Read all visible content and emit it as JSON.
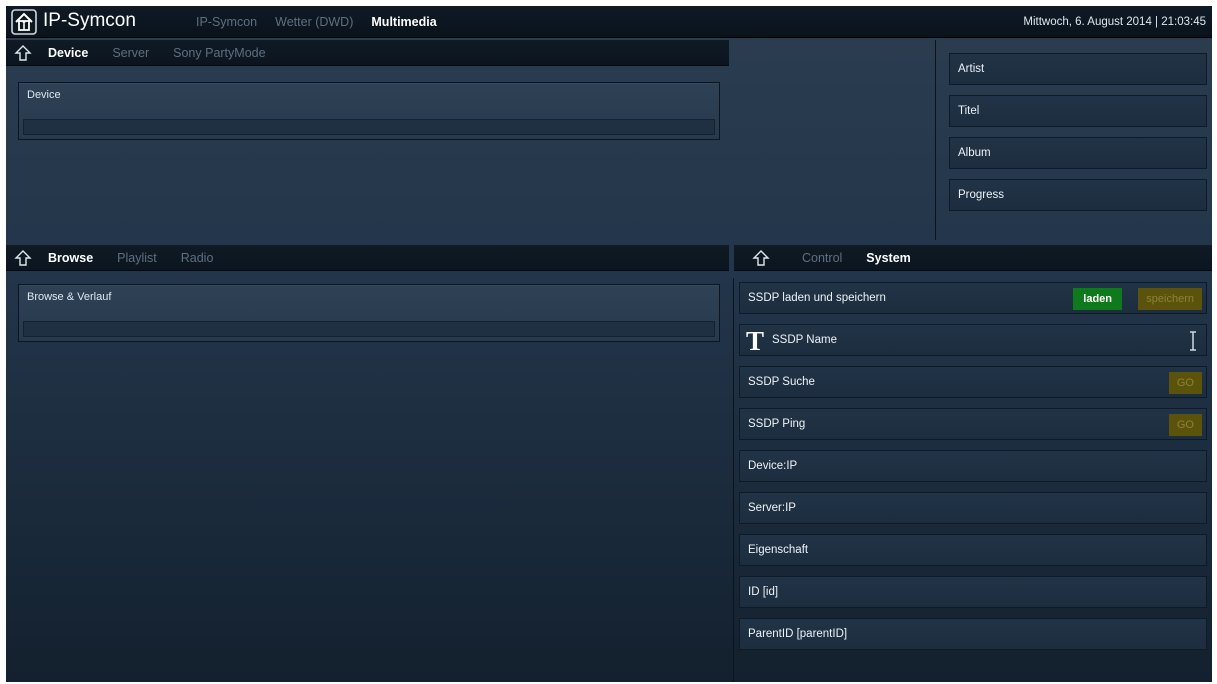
{
  "header": {
    "brand": "IP-Symcon",
    "nav": [
      "IP-Symcon",
      "Wetter (DWD)",
      "Multimedia"
    ],
    "active_nav": "Multimedia",
    "datetime": "Mittwoch, 6. August 2014 | 21:03:45"
  },
  "device_section": {
    "tabs": [
      "Device",
      "Server",
      "Sony PartyMode"
    ],
    "active_tab": "Device",
    "panel_title": "Device"
  },
  "media_info": {
    "fields": [
      "Artist",
      "Titel",
      "Album",
      "Progress"
    ]
  },
  "browse_section": {
    "tabs": [
      "Browse",
      "Playlist",
      "Radio"
    ],
    "active_tab": "Browse",
    "panel_title": "Browse & Verlauf"
  },
  "system_section": {
    "tabs": [
      "Control",
      "System"
    ],
    "active_tab": "System",
    "rows": {
      "ssdp_load_save": "SSDP laden und speichern",
      "load_button": "laden",
      "save_button": "speichern",
      "ssdp_name": "SSDP Name",
      "ssdp_search": "SSDP Suche",
      "ssdp_search_go": "GO",
      "ssdp_ping": "SSDP Ping",
      "ssdp_ping_go": "GO",
      "device_ip": "Device:IP",
      "server_ip": "Server:IP",
      "eigenschaft": "Eigenschaft",
      "id": "ID [id]",
      "parent_id": "ParentID [parentID]"
    }
  },
  "colors": {
    "accent_green": "#0f7a1c",
    "olive_button": "#5b520c",
    "background_top": "#2b3d4f"
  }
}
